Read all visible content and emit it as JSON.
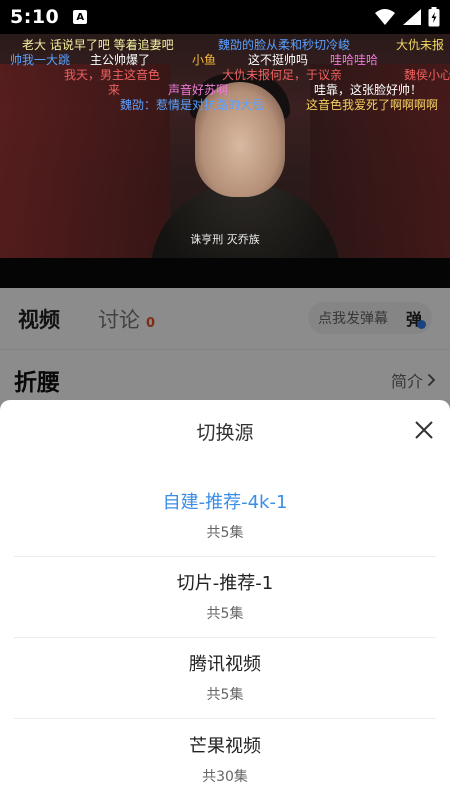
{
  "status_bar": {
    "time": "5:10",
    "notification_letter": "A",
    "icons": [
      "wifi-icon",
      "signal-icon",
      "battery-icon"
    ]
  },
  "video": {
    "subtitle": "诛亨刑 灭乔族",
    "danmaku": [
      {
        "text": "老大 话说早了吧 等着追妻吧",
        "color": "#f4f1a0"
      },
      {
        "text": "魏劭的脸从柔和秒切冷峻",
        "color": "#5aa0ff"
      },
      {
        "text": "大仇未报",
        "color": "#f0d860"
      },
      {
        "text": "帅我一大跳",
        "color": "#5aa0ff"
      },
      {
        "text": "主公帅爆了",
        "color": "#ffffff"
      },
      {
        "text": "小鱼",
        "color": "#f5b93c"
      },
      {
        "text": "这不挺帅吗",
        "color": "#ffffff"
      },
      {
        "text": "哇哈哇哈",
        "color": "#f07ad8"
      },
      {
        "text": "我天，男主这音色",
        "color": "#f06060"
      },
      {
        "text": "大仇未报何足，于议亲",
        "color": "#f06060"
      },
      {
        "text": "魏侯小心",
        "color": "#f06060"
      },
      {
        "text": "来",
        "color": "#f06060"
      },
      {
        "text": "声音好苏啊",
        "color": "#f07ad8"
      },
      {
        "text": "哇靠，这张脸好帅！",
        "color": "#ffffff"
      },
      {
        "text": "魏劭：惹情是对抗路的大忌",
        "color": "#5aa0ff"
      },
      {
        "text": "这音色我爱死了啊啊啊啊",
        "color": "#f5d060"
      }
    ]
  },
  "tabs": [
    {
      "label": "视频",
      "active": true
    },
    {
      "label": "讨论",
      "count": "0",
      "active": false
    }
  ],
  "danmaku_input": {
    "placeholder": "点我发弹幕",
    "button_glyph": "弹"
  },
  "show": {
    "title": "折腰",
    "intro_label": "简介"
  },
  "sheet": {
    "title": "切换源",
    "sources": [
      {
        "name": "自建-推荐-4k-1",
        "episodes": "共5集",
        "selected": true
      },
      {
        "name": "切片-推荐-1",
        "episodes": "共5集",
        "selected": false
      },
      {
        "name": "腾讯视频",
        "episodes": "共5集",
        "selected": false
      },
      {
        "name": "芒果视频",
        "episodes": "共30集",
        "selected": false
      }
    ]
  },
  "colors": {
    "accent": "#3a8ee6",
    "count_badge": "#e8512b"
  }
}
